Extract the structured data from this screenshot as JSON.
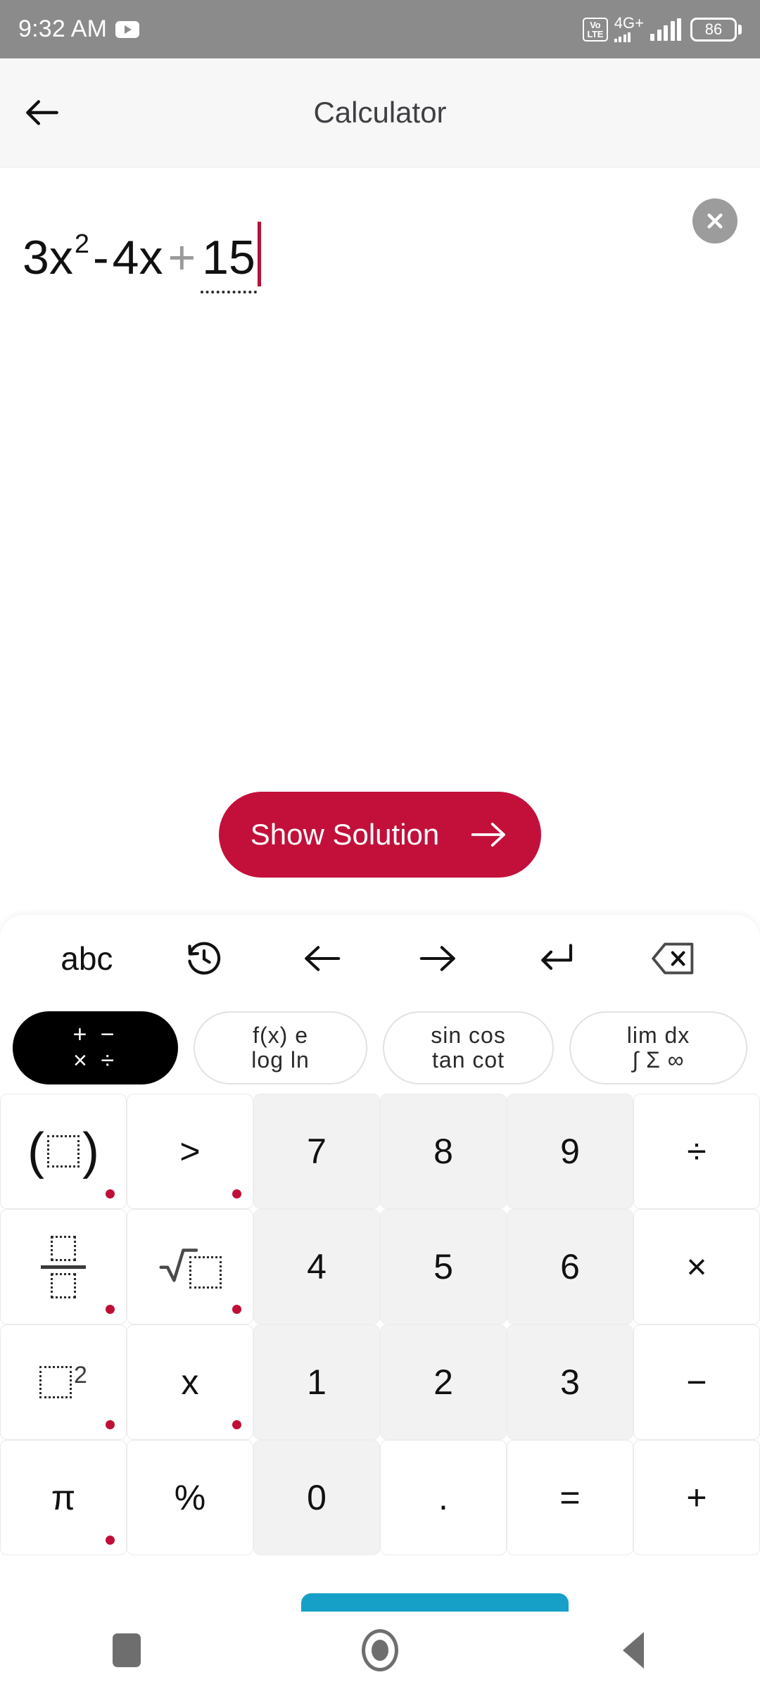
{
  "status_bar": {
    "time": "9:32 AM",
    "youtube_icon": "youtube-icon",
    "volte_line1": "Vo",
    "volte_line2": "LTE",
    "network_label": "4G+",
    "battery_level": "86"
  },
  "app_bar": {
    "back_icon": "back-arrow-icon",
    "title": "Calculator"
  },
  "expression": {
    "base1": "3x",
    "exponent1": "2",
    "minus": "-",
    "term2": "4x",
    "plus": "+",
    "term3": "15",
    "clear_icon": "close-icon"
  },
  "solution": {
    "label": "Show Solution",
    "arrow_icon": "arrow-right-icon"
  },
  "keyboard": {
    "tools": [
      {
        "name": "abc-key",
        "label": "abc",
        "type": "text"
      },
      {
        "name": "history-icon",
        "label": "history",
        "type": "icon"
      },
      {
        "name": "arrow-left-icon",
        "label": "←",
        "type": "icon"
      },
      {
        "name": "arrow-right-icon",
        "label": "→",
        "type": "icon"
      },
      {
        "name": "enter-icon",
        "label": "↵",
        "type": "icon"
      },
      {
        "name": "backspace-icon",
        "label": "⌫",
        "type": "icon"
      }
    ],
    "chips": [
      {
        "name": "chip-arithmetic",
        "row1": "+ −",
        "row2": "× ÷",
        "active": true
      },
      {
        "name": "chip-functions",
        "row1": "f(x)  e",
        "row2": "log  ln",
        "active": false
      },
      {
        "name": "chip-trigonometry",
        "row1": "sin cos",
        "row2": "tan cot",
        "active": false
      },
      {
        "name": "chip-calculus",
        "row1": "lim  dx",
        "row2": "∫ Σ ∞",
        "active": false
      }
    ],
    "keys": [
      [
        {
          "name": "key-parentheses",
          "label": "( □ )",
          "kind": "paren",
          "num": false,
          "dot": true
        },
        {
          "name": "key-greater-than",
          "label": ">",
          "kind": "text",
          "num": false,
          "dot": true
        },
        {
          "name": "key-7",
          "label": "7",
          "kind": "text",
          "num": true,
          "dot": false
        },
        {
          "name": "key-8",
          "label": "8",
          "kind": "text",
          "num": true,
          "dot": false
        },
        {
          "name": "key-9",
          "label": "9",
          "kind": "text",
          "num": true,
          "dot": false
        },
        {
          "name": "key-divide",
          "label": "÷",
          "kind": "text",
          "num": false,
          "dot": false
        }
      ],
      [
        {
          "name": "key-fraction",
          "label": "□/□",
          "kind": "frac",
          "num": false,
          "dot": true
        },
        {
          "name": "key-square-root",
          "label": "√□",
          "kind": "sqrt",
          "num": false,
          "dot": true
        },
        {
          "name": "key-4",
          "label": "4",
          "kind": "text",
          "num": true,
          "dot": false
        },
        {
          "name": "key-5",
          "label": "5",
          "kind": "text",
          "num": true,
          "dot": false
        },
        {
          "name": "key-6",
          "label": "6",
          "kind": "text",
          "num": true,
          "dot": false
        },
        {
          "name": "key-multiply",
          "label": "×",
          "kind": "text",
          "num": false,
          "dot": false
        }
      ],
      [
        {
          "name": "key-power",
          "label": "□²",
          "kind": "sup",
          "num": false,
          "dot": true
        },
        {
          "name": "key-variable-x",
          "label": "x",
          "kind": "text",
          "num": false,
          "dot": true
        },
        {
          "name": "key-1",
          "label": "1",
          "kind": "text",
          "num": true,
          "dot": false
        },
        {
          "name": "key-2",
          "label": "2",
          "kind": "text",
          "num": true,
          "dot": false
        },
        {
          "name": "key-3",
          "label": "3",
          "kind": "text",
          "num": true,
          "dot": false
        },
        {
          "name": "key-minus",
          "label": "−",
          "kind": "text",
          "num": false,
          "dot": false
        }
      ],
      [
        {
          "name": "key-pi",
          "label": "π",
          "kind": "text",
          "num": false,
          "dot": true
        },
        {
          "name": "key-percent",
          "label": "%",
          "kind": "text",
          "num": false,
          "dot": false
        },
        {
          "name": "key-0",
          "label": "0",
          "kind": "text",
          "num": true,
          "dot": false
        },
        {
          "name": "key-decimal-point",
          "label": ".",
          "kind": "text",
          "num": false,
          "dot": false
        },
        {
          "name": "key-equals",
          "label": "=",
          "kind": "text",
          "num": false,
          "dot": false
        },
        {
          "name": "key-plus",
          "label": "+",
          "kind": "text",
          "num": false,
          "dot": false
        }
      ]
    ]
  },
  "nav_bar": {
    "recents_icon": "recents-icon",
    "home_icon": "home-icon",
    "back_icon": "back-triangle-icon"
  },
  "colors": {
    "accent_red": "#c2103a",
    "cursor_red": "#b3123a",
    "dot_red": "#bf0f36",
    "teal": "#16a0c8",
    "status_gray": "#8b8b8b",
    "key_num_bg": "#f2f2f2"
  }
}
